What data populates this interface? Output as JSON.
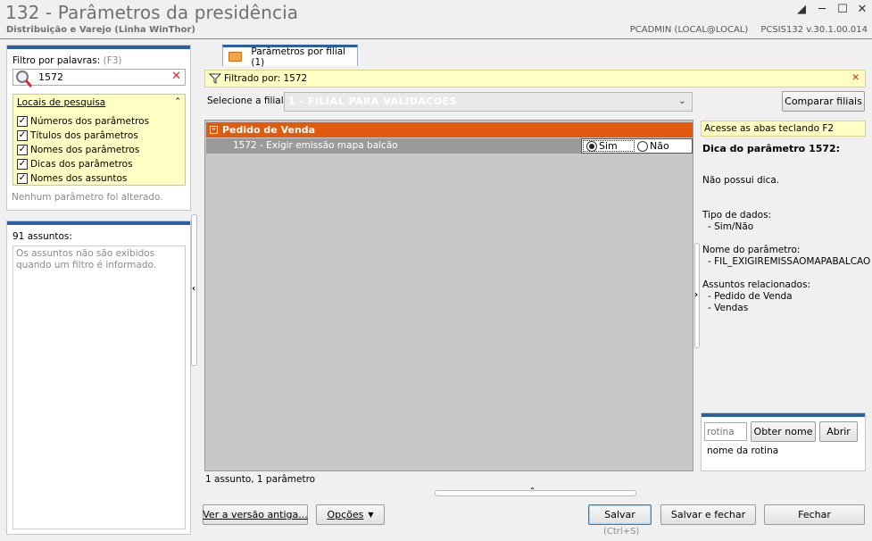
{
  "window": {
    "title": "132 - Parâmetros da presidência",
    "subtitle": "Distribuição e Varejo (Linha WinThor)",
    "user": "PCADMIN (LOCAL@LOCAL)",
    "version": "PCSIS132  v.30.1.00.014"
  },
  "filter": {
    "label": "Filtro por palavras:",
    "shortcut": "(F3)",
    "value": "1572",
    "locations_title": "Locais de pesquisa",
    "checks": [
      {
        "label": "Números dos parâmetros",
        "checked": true
      },
      {
        "label": "Títulos dos parâmetros",
        "checked": true
      },
      {
        "label": "Nomes dos parâmetros",
        "checked": true
      },
      {
        "label": "Dicas dos parâmetros",
        "checked": true
      },
      {
        "label": "Nomes dos assuntos",
        "checked": true
      }
    ],
    "status": "Nenhum parâmetro foi alterado."
  },
  "subjects": {
    "count_label": "91 assuntos:",
    "info": "Os assuntos não são exibidos quando um filtro é informado."
  },
  "tab": {
    "label": "Parâmetros por filial  (1)"
  },
  "filterbar": {
    "text": "Filtrado por: 1572"
  },
  "branch": {
    "label": "Selecione a filial:",
    "value": "1 - FILIAL PARA VALIDACOES",
    "compare_button": "Comparar filiais"
  },
  "grid": {
    "group": "Pedido de Venda",
    "rows": [
      {
        "label": "1572 - Exigir emissão mapa balcão",
        "opt_yes": "Sim",
        "opt_no": "Não",
        "selected": "Sim"
      }
    ],
    "footer": "1 assunto, 1 parâmetro"
  },
  "hint": {
    "bar": "Acesse as abas teclando F2",
    "title": "Dica do parâmetro 1572:",
    "no_hint": "Não possui dica.",
    "type_label": "Tipo de dados:",
    "type_value": "- Sim/Não",
    "name_label": "Nome do parâmetro:",
    "name_value": "- FIL_EXIGIREMISSAOMAPABALCAO",
    "related_label": "Assuntos relacionados:",
    "related": [
      "- Pedido de Venda",
      "- Vendas"
    ]
  },
  "routine": {
    "placeholder": "rotina",
    "get_name_button": "Obter nome",
    "open_button": "Abrir",
    "name_label": "nome da rotina"
  },
  "footer": {
    "old_version_button": "Ver a versão antiga...",
    "options_button": "Opções",
    "save_button": "Salvar",
    "save_shortcut": "(Ctrl+S)",
    "save_close_button": "Salvar e fechar",
    "close_button": "Fechar"
  },
  "colors": {
    "accent": "#2b5fa8",
    "group_header": "#e05a10",
    "highlight": "#ffffc4"
  }
}
